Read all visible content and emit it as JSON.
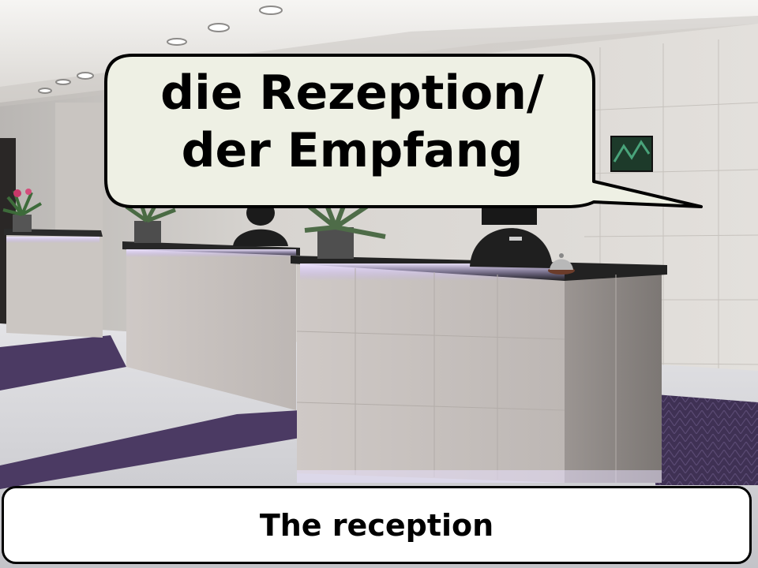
{
  "slide": {
    "speech_bubble": {
      "line1": "die Rezeption/",
      "line2": "der Empfang"
    },
    "caption": "The reception",
    "photo": {
      "subject": "hotel-reception-desk",
      "colors": {
        "wall": "#d8d4cf",
        "ceiling": "#e9e7e4",
        "carpet": "#4b3a63",
        "floor": "#cfcfd2",
        "counter_top": "#222222",
        "led_glow": "#d9c8ff",
        "bubble_fill": "#eef0e4"
      }
    }
  }
}
